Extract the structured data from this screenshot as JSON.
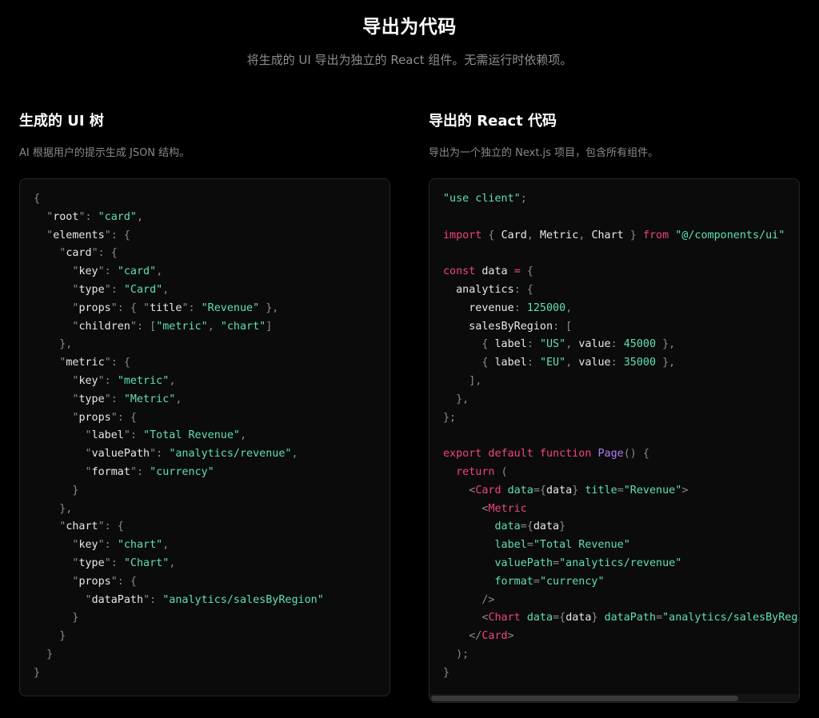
{
  "header": {
    "title": "导出为代码",
    "subtitle": "将生成的 UI 导出为独立的 React 组件。无需运行时依赖项。"
  },
  "left_panel": {
    "title": "生成的 UI 树",
    "description": "AI 根据用户的提示生成 JSON 结构。",
    "code_lines": [
      [
        [
          "p",
          "{"
        ]
      ],
      [
        [
          "p",
          "  \""
        ],
        [
          "k",
          "root"
        ],
        [
          "p",
          "\": "
        ],
        [
          "s",
          "\"card\""
        ],
        [
          "p",
          ","
        ]
      ],
      [
        [
          "p",
          "  \""
        ],
        [
          "k",
          "elements"
        ],
        [
          "p",
          "\": {"
        ]
      ],
      [
        [
          "p",
          "    \""
        ],
        [
          "k",
          "card"
        ],
        [
          "p",
          "\": {"
        ]
      ],
      [
        [
          "p",
          "      \""
        ],
        [
          "k",
          "key"
        ],
        [
          "p",
          "\": "
        ],
        [
          "s",
          "\"card\""
        ],
        [
          "p",
          ","
        ]
      ],
      [
        [
          "p",
          "      \""
        ],
        [
          "k",
          "type"
        ],
        [
          "p",
          "\": "
        ],
        [
          "s",
          "\"Card\""
        ],
        [
          "p",
          ","
        ]
      ],
      [
        [
          "p",
          "      \""
        ],
        [
          "k",
          "props"
        ],
        [
          "p",
          "\": { \""
        ],
        [
          "k",
          "title"
        ],
        [
          "p",
          "\": "
        ],
        [
          "s",
          "\"Revenue\""
        ],
        [
          "p",
          " },"
        ]
      ],
      [
        [
          "p",
          "      \""
        ],
        [
          "k",
          "children"
        ],
        [
          "p",
          "\": ["
        ],
        [
          "s",
          "\"metric\""
        ],
        [
          "p",
          ", "
        ],
        [
          "s",
          "\"chart\""
        ],
        [
          "p",
          "]"
        ]
      ],
      [
        [
          "p",
          "    },"
        ]
      ],
      [
        [
          "p",
          "    \""
        ],
        [
          "k",
          "metric"
        ],
        [
          "p",
          "\": {"
        ]
      ],
      [
        [
          "p",
          "      \""
        ],
        [
          "k",
          "key"
        ],
        [
          "p",
          "\": "
        ],
        [
          "s",
          "\"metric\""
        ],
        [
          "p",
          ","
        ]
      ],
      [
        [
          "p",
          "      \""
        ],
        [
          "k",
          "type"
        ],
        [
          "p",
          "\": "
        ],
        [
          "s",
          "\"Metric\""
        ],
        [
          "p",
          ","
        ]
      ],
      [
        [
          "p",
          "      \""
        ],
        [
          "k",
          "props"
        ],
        [
          "p",
          "\": {"
        ]
      ],
      [
        [
          "p",
          "        \""
        ],
        [
          "k",
          "label"
        ],
        [
          "p",
          "\": "
        ],
        [
          "s",
          "\"Total Revenue\""
        ],
        [
          "p",
          ","
        ]
      ],
      [
        [
          "p",
          "        \""
        ],
        [
          "k",
          "valuePath"
        ],
        [
          "p",
          "\": "
        ],
        [
          "s",
          "\"analytics/revenue\""
        ],
        [
          "p",
          ","
        ]
      ],
      [
        [
          "p",
          "        \""
        ],
        [
          "k",
          "format"
        ],
        [
          "p",
          "\": "
        ],
        [
          "s",
          "\"currency\""
        ]
      ],
      [
        [
          "p",
          "      }"
        ]
      ],
      [
        [
          "p",
          "    },"
        ]
      ],
      [
        [
          "p",
          "    \""
        ],
        [
          "k",
          "chart"
        ],
        [
          "p",
          "\": {"
        ]
      ],
      [
        [
          "p",
          "      \""
        ],
        [
          "k",
          "key"
        ],
        [
          "p",
          "\": "
        ],
        [
          "s",
          "\"chart\""
        ],
        [
          "p",
          ","
        ]
      ],
      [
        [
          "p",
          "      \""
        ],
        [
          "k",
          "type"
        ],
        [
          "p",
          "\": "
        ],
        [
          "s",
          "\"Chart\""
        ],
        [
          "p",
          ","
        ]
      ],
      [
        [
          "p",
          "      \""
        ],
        [
          "k",
          "props"
        ],
        [
          "p",
          "\": {"
        ]
      ],
      [
        [
          "p",
          "        \""
        ],
        [
          "k",
          "dataPath"
        ],
        [
          "p",
          "\": "
        ],
        [
          "s",
          "\"analytics/salesByRegion\""
        ]
      ],
      [
        [
          "p",
          "      }"
        ]
      ],
      [
        [
          "p",
          "    }"
        ]
      ],
      [
        [
          "p",
          "  }"
        ]
      ],
      [
        [
          "p",
          "}"
        ]
      ]
    ]
  },
  "right_panel": {
    "title": "导出的 React 代码",
    "description": "导出为一个独立的 Next.js 项目，包含所有组件。",
    "code_lines": [
      [
        [
          "s",
          "\"use client\""
        ],
        [
          "p",
          ";"
        ]
      ],
      [],
      [
        [
          "kw",
          "import"
        ],
        [
          "p",
          " { "
        ],
        [
          "id",
          "Card"
        ],
        [
          "p",
          ", "
        ],
        [
          "id",
          "Metric"
        ],
        [
          "p",
          ", "
        ],
        [
          "id",
          "Chart"
        ],
        [
          "p",
          " } "
        ],
        [
          "kw",
          "from"
        ],
        [
          "p",
          " "
        ],
        [
          "s",
          "\"@/components/ui\""
        ]
      ],
      [],
      [
        [
          "kw",
          "const"
        ],
        [
          "id",
          " data"
        ],
        [
          "p",
          " "
        ],
        [
          "kw",
          "="
        ],
        [
          "p",
          " {"
        ]
      ],
      [
        [
          "id",
          "  analytics"
        ],
        [
          "p",
          ": {"
        ]
      ],
      [
        [
          "id",
          "    revenue"
        ],
        [
          "p",
          ": "
        ],
        [
          "num",
          "125000"
        ],
        [
          "p",
          ","
        ]
      ],
      [
        [
          "id",
          "    salesByRegion"
        ],
        [
          "p",
          ": ["
        ]
      ],
      [
        [
          "p",
          "      { "
        ],
        [
          "id",
          "label"
        ],
        [
          "p",
          ": "
        ],
        [
          "s",
          "\"US\""
        ],
        [
          "p",
          ", "
        ],
        [
          "id",
          "value"
        ],
        [
          "p",
          ": "
        ],
        [
          "num",
          "45000"
        ],
        [
          "p",
          " },"
        ]
      ],
      [
        [
          "p",
          "      { "
        ],
        [
          "id",
          "label"
        ],
        [
          "p",
          ": "
        ],
        [
          "s",
          "\"EU\""
        ],
        [
          "p",
          ", "
        ],
        [
          "id",
          "value"
        ],
        [
          "p",
          ": "
        ],
        [
          "num",
          "35000"
        ],
        [
          "p",
          " },"
        ]
      ],
      [
        [
          "p",
          "    ],"
        ]
      ],
      [
        [
          "p",
          "  },"
        ]
      ],
      [
        [
          "p",
          "};"
        ]
      ],
      [],
      [
        [
          "kw",
          "export default function"
        ],
        [
          "p",
          " "
        ],
        [
          "fn",
          "Page"
        ],
        [
          "p",
          "() {"
        ]
      ],
      [
        [
          "kw",
          "  return"
        ],
        [
          "p",
          " ("
        ]
      ],
      [
        [
          "p",
          "    <"
        ],
        [
          "tag",
          "Card"
        ],
        [
          "p",
          " "
        ],
        [
          "attr",
          "data"
        ],
        [
          "p",
          "={"
        ],
        [
          "id",
          "data"
        ],
        [
          "p",
          "} "
        ],
        [
          "attr",
          "title"
        ],
        [
          "p",
          "="
        ],
        [
          "s",
          "\"Revenue\""
        ],
        [
          "p",
          ">"
        ]
      ],
      [
        [
          "p",
          "      <"
        ],
        [
          "tag",
          "Metric"
        ]
      ],
      [
        [
          "p",
          "        "
        ],
        [
          "attr",
          "data"
        ],
        [
          "p",
          "={"
        ],
        [
          "id",
          "data"
        ],
        [
          "p",
          "}"
        ]
      ],
      [
        [
          "p",
          "        "
        ],
        [
          "attr",
          "label"
        ],
        [
          "p",
          "="
        ],
        [
          "s",
          "\"Total Revenue\""
        ]
      ],
      [
        [
          "p",
          "        "
        ],
        [
          "attr",
          "valuePath"
        ],
        [
          "p",
          "="
        ],
        [
          "s",
          "\"analytics/revenue\""
        ]
      ],
      [
        [
          "p",
          "        "
        ],
        [
          "attr",
          "format"
        ],
        [
          "p",
          "="
        ],
        [
          "s",
          "\"currency\""
        ]
      ],
      [
        [
          "p",
          "      />"
        ]
      ],
      [
        [
          "p",
          "      <"
        ],
        [
          "tag",
          "Chart"
        ],
        [
          "p",
          " "
        ],
        [
          "attr",
          "data"
        ],
        [
          "p",
          "={"
        ],
        [
          "id",
          "data"
        ],
        [
          "p",
          "} "
        ],
        [
          "attr",
          "dataPath"
        ],
        [
          "p",
          "="
        ],
        [
          "s",
          "\"analytics/salesByRegion\""
        ],
        [
          "p",
          " />"
        ]
      ],
      [
        [
          "p",
          "    </"
        ],
        [
          "tag",
          "Card"
        ],
        [
          "p",
          ">"
        ]
      ],
      [
        [
          "p",
          "  );"
        ]
      ],
      [
        [
          "p",
          "}"
        ]
      ]
    ]
  }
}
